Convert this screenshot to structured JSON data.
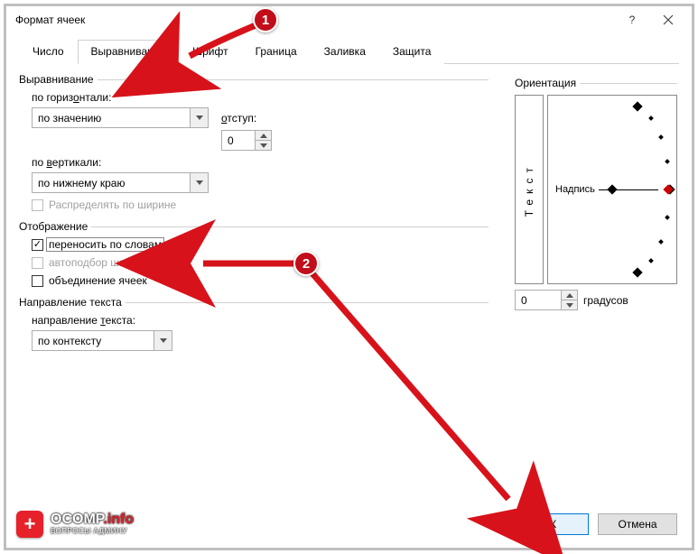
{
  "window": {
    "title": "Формат ячеек",
    "help_symbol": "?",
    "close_label": "close"
  },
  "tabs": {
    "items": [
      "Число",
      "Выравнивание",
      "Шрифт",
      "Граница",
      "Заливка",
      "Защита"
    ],
    "active_index": 1
  },
  "alignment": {
    "group_label": "Выравнивание",
    "horizontal_label": "по горизонтали:",
    "horizontal_value": "по значению",
    "indent_label": "отступ:",
    "indent_value": "0",
    "vertical_label": "по вертикали:",
    "vertical_value": "по нижнему краю",
    "distribute_label": "Распределять по ширине"
  },
  "display": {
    "group_label": "Отображение",
    "wrap_label": "переносить по словам",
    "wrap_checked": true,
    "autofit_label": "автоподбор ширины",
    "merge_label": "объединение ячеек"
  },
  "direction": {
    "group_label": "Направление текста",
    "label": "направление текста:",
    "value": "по контексту"
  },
  "orientation": {
    "group_label": "Ориентация",
    "vertical_text": "Текст",
    "dial_label": "Надпись",
    "degrees_value": "0",
    "degrees_unit": "градусов"
  },
  "buttons": {
    "ok": "ОК",
    "cancel": "Отмена"
  },
  "annotations": {
    "m1": "1",
    "m2": "2"
  },
  "logo": {
    "brand1": "OCOMP",
    "brand2": ".info",
    "tagline": "ВОПРОСЫ АДМИНУ"
  }
}
